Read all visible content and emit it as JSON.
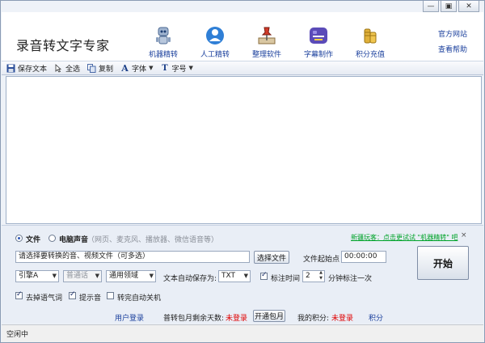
{
  "app": {
    "title": "录音转文字专家"
  },
  "window_controls": {
    "minimize": "—",
    "restore": "▣",
    "close": "✕"
  },
  "header_nav": [
    {
      "label": "机器精转",
      "icon": "robot-icon"
    },
    {
      "label": "人工精转",
      "icon": "person-icon"
    },
    {
      "label": "整理软件",
      "icon": "pushpin-icon"
    },
    {
      "label": "字幕制作",
      "icon": "subtitle-icon"
    },
    {
      "label": "积分充值",
      "icon": "coins-icon"
    }
  ],
  "header_links": {
    "official_site": "官方网站",
    "help": "查看帮助"
  },
  "toolbar": {
    "save_text": "保存文本",
    "select_all": "全选",
    "copy": "复制",
    "font": "字体",
    "font_size": "字号"
  },
  "source": {
    "file_label": "文件",
    "computer_sound_label": "电脑声音",
    "computer_sound_hint": "（网页、麦克风、播放器、微信语音等）",
    "selected": "file"
  },
  "promo_link": "新疆玩客：点击更试试 \"机器精转\" 吧",
  "file_input": {
    "value": "请选择要转换的音、视频文件（可多选）"
  },
  "select_file_button": "选择文件",
  "start_point_label": "文件起始点",
  "start_point_value": "00:00:00",
  "start_button": "开始",
  "engine_select": "引擎A",
  "dialect_select": "普通话",
  "domain_select": "通用领域",
  "autosave_label": "文本自动保存为:",
  "autosave_select": "TXT",
  "mark_time": {
    "label": "标注时间",
    "checked": true,
    "interval": "2",
    "unit_label": "分钟标注一次"
  },
  "options": [
    {
      "label": "去掉语气词",
      "checked": true
    },
    {
      "label": "提示音",
      "checked": true
    },
    {
      "label": "转完自动关机",
      "checked": false
    }
  ],
  "account_bar": {
    "user_login": "用户登录",
    "monthly_days_label": "普转包月剩余天数:",
    "monthly_days_value": "未登录",
    "open_monthly_button": "开通包月",
    "my_points_label": "我的积分:",
    "my_points_value": "未登录",
    "points_recharge": "积分"
  },
  "status_bar": {
    "text": "空闲中"
  },
  "colors": {
    "accent": "#1a3f9c",
    "warning": "#e00000",
    "promo": "#00a32a"
  }
}
